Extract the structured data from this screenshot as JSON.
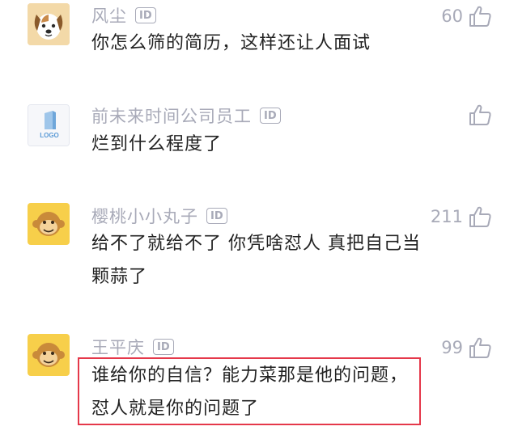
{
  "comments": [
    {
      "username": "风尘",
      "badge": "ID",
      "likes": "60",
      "lines": [
        "你怎么筛的简历，这样还让人面试"
      ],
      "avatar_icon": "dog-avatar-icon"
    },
    {
      "username": "前未来时间公司员工",
      "badge": "ID",
      "likes": "",
      "lines": [
        "烂到什么程度了"
      ],
      "avatar_icon": "logo-placeholder-avatar",
      "avatar_text": "LOGO"
    },
    {
      "username": "樱桃小小丸子",
      "badge": "ID",
      "likes": "211",
      "lines": [
        "给不了就给不了 你凭啥怼人 真把自己当",
        "颗蒜了"
      ],
      "avatar_icon": "monkey-avatar-icon"
    },
    {
      "username": "王平庆",
      "badge": "ID",
      "likes": "99",
      "lines": [
        "谁给你的自信？能力菜那是他的问题，",
        "怼人就是你的问题了"
      ],
      "avatar_icon": "monkey-avatar-icon"
    }
  ],
  "colors": {
    "meta_gray": "#a8aab8",
    "text": "#222222",
    "highlight": "#e5384a",
    "avatar_yellow": "#f7cf4a"
  }
}
